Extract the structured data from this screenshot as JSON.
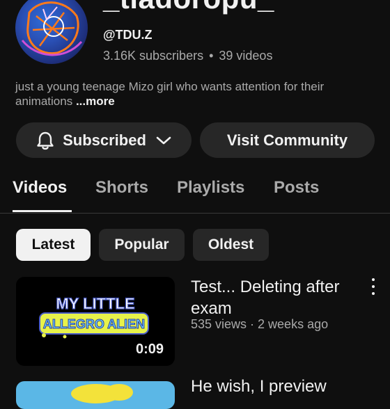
{
  "channel": {
    "title": "_tiadoropu_",
    "handle": "@TDU.Z",
    "subscribers": "3.16K subscribers",
    "separator": "•",
    "videos": "39 videos",
    "description": "just a young teenage Mizo girl who wants attention for their animations",
    "more_label": "...more"
  },
  "actions": {
    "subscribed_label": "Subscribed",
    "community_label": "Visit Community"
  },
  "tabs": [
    {
      "label": "Videos",
      "active": true
    },
    {
      "label": "Shorts",
      "active": false
    },
    {
      "label": "Playlists",
      "active": false
    },
    {
      "label": "Posts",
      "active": false
    }
  ],
  "chips": [
    {
      "label": "Latest",
      "active": true
    },
    {
      "label": "Popular",
      "active": false
    },
    {
      "label": "Oldest",
      "active": false
    }
  ],
  "videos": [
    {
      "title": "Test... Deleting after exam",
      "meta": "535 views · 2 weeks ago",
      "duration": "0:09",
      "thumb_text_top": "MY LITTLE",
      "thumb_text_bottom": "ALLEGRO ALIEN"
    },
    {
      "title": "He wish, I preview"
    }
  ],
  "colors": {
    "background": "#0f0f0f",
    "surface": "#272727",
    "text_primary": "#f1f1f1",
    "text_secondary": "#aaaaaa"
  }
}
